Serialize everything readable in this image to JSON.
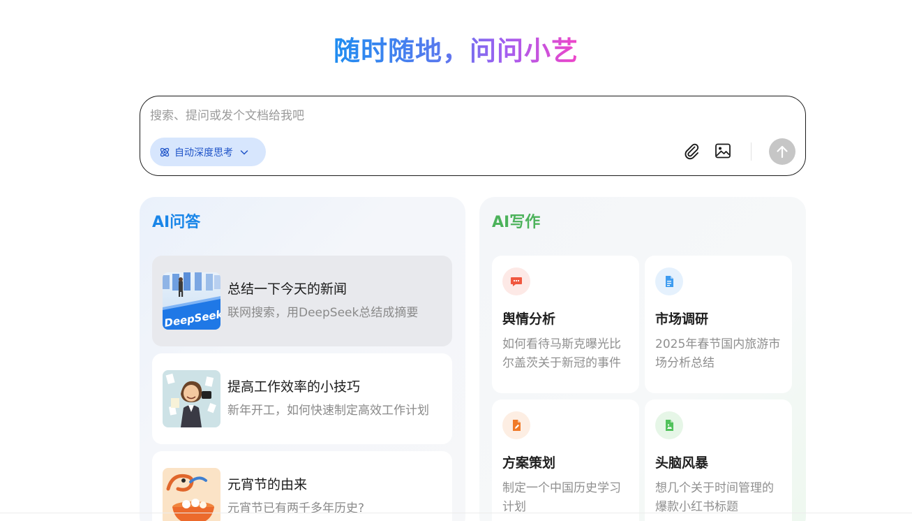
{
  "headline": "随时随地，问问小艺",
  "search": {
    "placeholder": "搜索、提问或发个文档给我吧",
    "think_mode_label": "自动深度思考"
  },
  "qa_panel": {
    "title": "AI问答",
    "cards": [
      {
        "title": "总结一下今天的新闻",
        "desc": "联网搜索，用DeepSeek总结成摘要",
        "thumb_text": "DeepSeek"
      },
      {
        "title": "提高工作效率的小技巧",
        "desc": "新年开工，如何快速制定高效工作计划"
      },
      {
        "title": "元宵节的由来",
        "desc": "元宵节已有两千多年历史?"
      }
    ]
  },
  "writing_panel": {
    "title": "AI写作",
    "cards": [
      {
        "title": "舆情分析",
        "desc": "如何看待马斯克曝光比尔盖茨关于新冠的事件",
        "icon": "chat-bubble-icon",
        "color": "#f0573f"
      },
      {
        "title": "市场调研",
        "desc": "2025年春节国内旅游市场分析总结",
        "icon": "document-icon",
        "color": "#3e9cf0"
      },
      {
        "title": "方案策划",
        "desc": "制定一个中国历史学习计划",
        "icon": "pen-doc-icon",
        "color": "#f07a28"
      },
      {
        "title": "头脑风暴",
        "desc": "想几个关于时间管理的爆款小红书标题",
        "icon": "image-doc-icon",
        "color": "#52c25c"
      }
    ]
  },
  "colors": {
    "qa_title": "#1a86e8",
    "writing_title": "#4cb25b",
    "think_pill_bg": "#d7e6fd",
    "send_button": "#c6c6c6"
  }
}
